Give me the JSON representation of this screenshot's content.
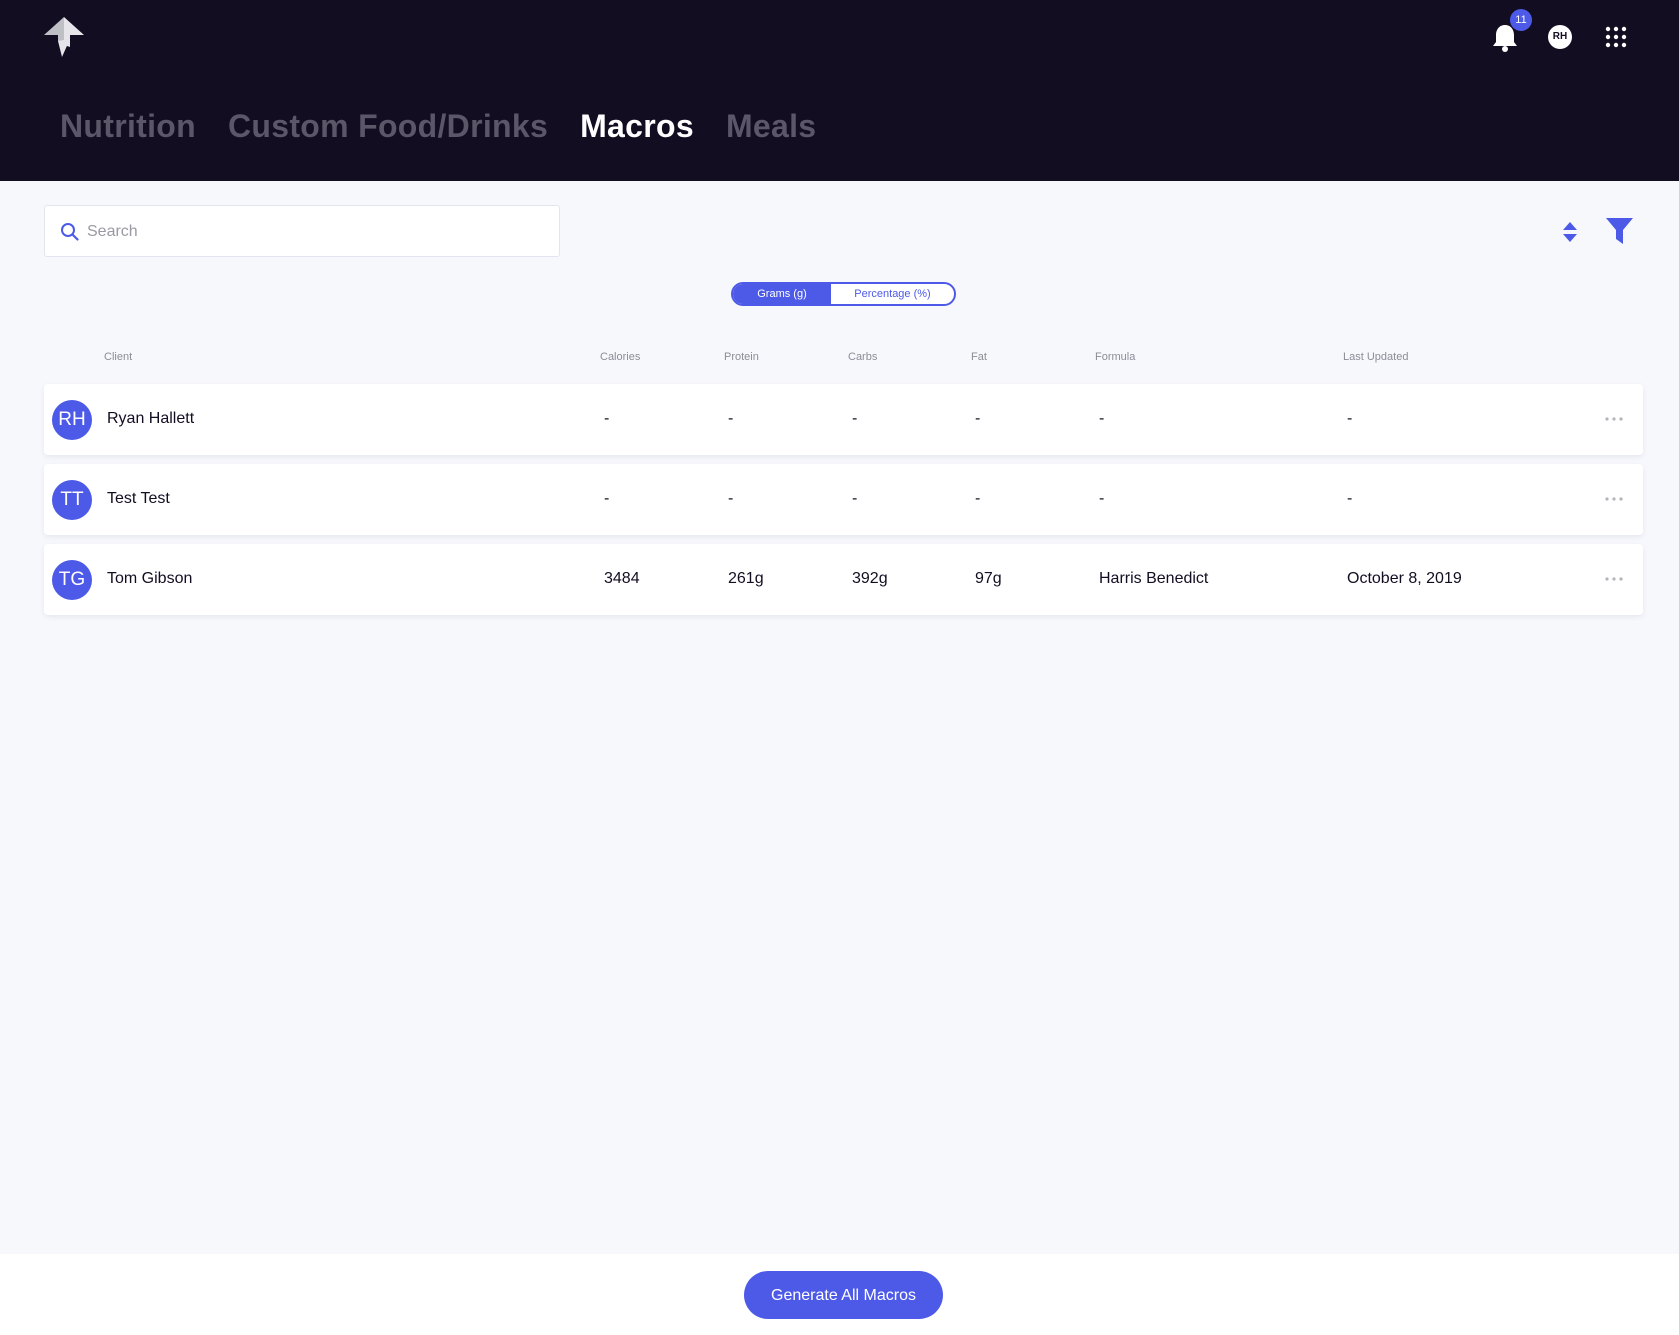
{
  "header": {
    "notification_count": "11",
    "user_initials": "RH",
    "tabs": [
      {
        "label": "Nutrition",
        "active": false
      },
      {
        "label": "Custom Food/Drinks",
        "active": false
      },
      {
        "label": "Macros",
        "active": true
      },
      {
        "label": "Meals",
        "active": false
      }
    ]
  },
  "toolbar": {
    "search_placeholder": "Search",
    "search_value": ""
  },
  "unit_toggle": {
    "grams_label": "Grams (g)",
    "percentage_label": "Percentage (%)",
    "selected": "Grams (g)"
  },
  "table": {
    "columns": [
      "Client",
      "Calories",
      "Protein",
      "Carbs",
      "Fat",
      "Formula",
      "Last Updated"
    ],
    "rows": [
      {
        "initials": "RH",
        "client": "Ryan Hallett",
        "calories": "-",
        "protein": "-",
        "carbs": "-",
        "fat": "-",
        "formula": "-",
        "last_updated": "-"
      },
      {
        "initials": "TT",
        "client": "Test Test",
        "calories": "-",
        "protein": "-",
        "carbs": "-",
        "fat": "-",
        "formula": "-",
        "last_updated": "-"
      },
      {
        "initials": "TG",
        "client": "Tom Gibson",
        "calories": "3484",
        "protein": "261g",
        "carbs": "392g",
        "fat": "97g",
        "formula": "Harris Benedict",
        "last_updated": "October 8, 2019"
      }
    ]
  },
  "footer": {
    "generate_label": "Generate All Macros"
  },
  "colors": {
    "accent": "#4d5ae8",
    "topbar": "#130d22",
    "background": "#f7f8fc"
  },
  "icons": [
    "logo-icon",
    "bell-icon",
    "apps-grid-icon",
    "search-icon",
    "sort-icon",
    "filter-icon",
    "more-icon"
  ]
}
